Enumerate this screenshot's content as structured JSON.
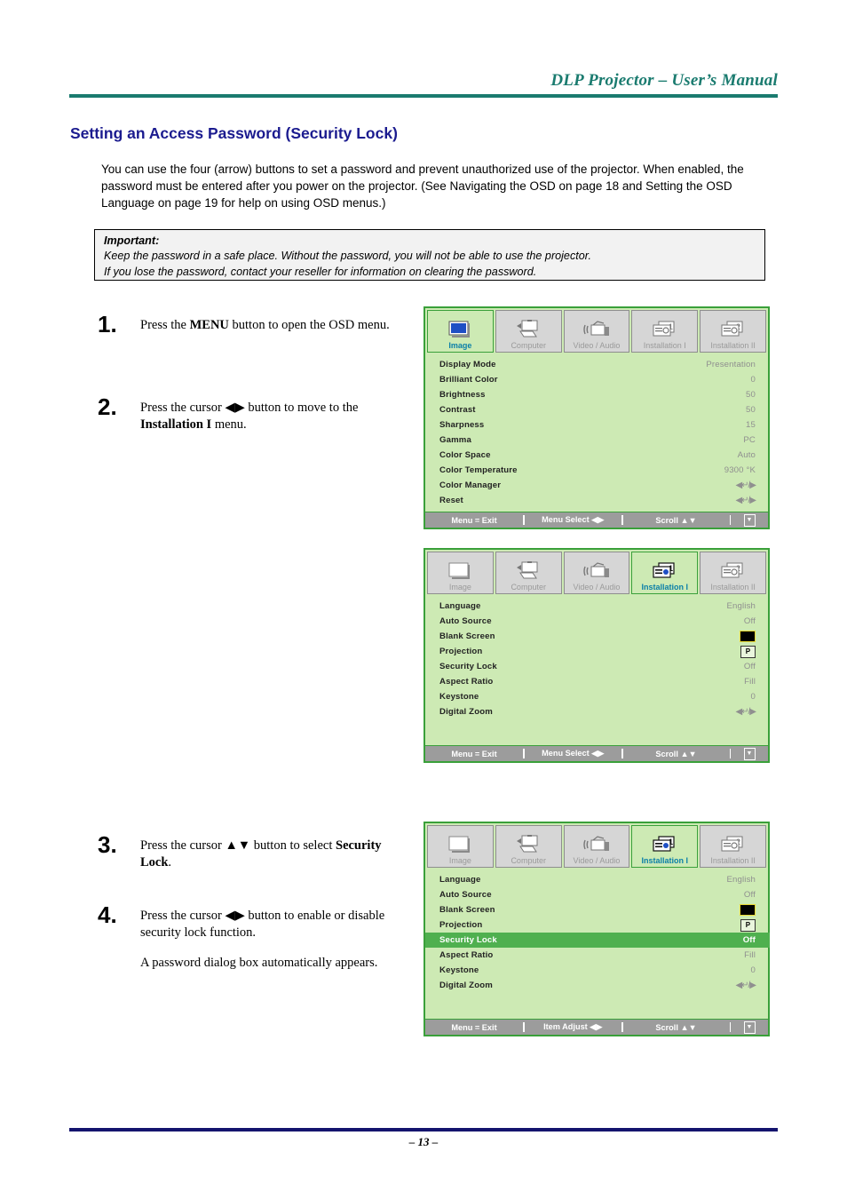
{
  "header": {
    "manual_title": "DLP Projector – User’s Manual",
    "accent_color": "#1a7b6f"
  },
  "section": {
    "heading": "Setting an Access Password (Security Lock)",
    "heading_color": "#1b1b8f",
    "intro": "You can use the four (arrow) buttons to set a password and prevent unauthorized use of the projector. When enabled, the password must be entered after you power on the projector. (See Navigating the OSD on page 18 and Setting the OSD Language on page 19 for help on using OSD menus.)"
  },
  "important": {
    "title": "Important:",
    "line1": "Keep the password in a safe place. Without the password, you will not be able to use the projector.",
    "line2": "If you lose the password, contact your reseller for information on clearing the password."
  },
  "steps": [
    {
      "number": "1.",
      "text_before": "Press the cursor ",
      "html_parts": [
        "Press the ",
        "MENU",
        " button to open the OSD menu."
      ],
      "lead": "Press the ",
      "bold": "MENU",
      "rest": " button to open the OSD menu."
    },
    {
      "number": "2.",
      "lead": "Press the cursor ◀▶ button to move to the ",
      "bold": "Installation I",
      "rest": " menu."
    },
    {
      "number": "3.",
      "lead": "Press the cursor ▲▼ button to select ",
      "bold": "Security Lock",
      "rest": "."
    },
    {
      "number": "4.",
      "lead": "Press the cursor ◀▶ button to enable or disable security lock function.",
      "bold": "",
      "rest": "",
      "note": "A password dialog box automatically appears."
    }
  ],
  "osd_common": {
    "tabs": [
      {
        "label": "Image",
        "icon": "screen-icon"
      },
      {
        "label": "Computer",
        "icon": "computer-icon"
      },
      {
        "label": "Video / Audio",
        "icon": "video-audio-icon"
      },
      {
        "label": "Installation I",
        "icon": "installation-1-icon"
      },
      {
        "label": "Installation II",
        "icon": "installation-2-icon"
      }
    ],
    "footer": {
      "exit": "Menu = Exit",
      "menu_select": "Menu Select ◀▶",
      "item_adjust": "Item Adjust ◀▶",
      "scroll": "Scroll ▲▼",
      "scroll_indicator": "▼"
    },
    "panel_bg": "#cdeab4",
    "border_color": "#3aa03a",
    "highlight_color": "#4fb04f",
    "footer_bar_color": "#9c9c9c"
  },
  "osd1": {
    "active_tab": "Image",
    "rows": [
      {
        "label": "Display Mode",
        "value": "Presentation"
      },
      {
        "label": "Brilliant Color",
        "value": "0"
      },
      {
        "label": "Brightness",
        "value": "50"
      },
      {
        "label": "Contrast",
        "value": "50"
      },
      {
        "label": "Sharpness",
        "value": "15"
      },
      {
        "label": "Gamma",
        "value": "PC"
      },
      {
        "label": "Color Space",
        "value": "Auto"
      },
      {
        "label": "Color Temperature",
        "value": "9300 °K"
      },
      {
        "label": "Color Manager",
        "value": "◀↵/▶",
        "type": "enter"
      },
      {
        "label": "Reset",
        "value": "◀↵/▶",
        "type": "enter"
      }
    ],
    "footer_mode": "Menu Select ◀▶"
  },
  "osd2": {
    "active_tab": "Installation I",
    "rows": [
      {
        "label": "Language",
        "value": "English"
      },
      {
        "label": "Auto Source",
        "value": "Off"
      },
      {
        "label": "Blank Screen",
        "value": "",
        "type": "swatch"
      },
      {
        "label": "Projection",
        "value": "P",
        "type": "projection"
      },
      {
        "label": "Security Lock",
        "value": "Off"
      },
      {
        "label": "Aspect Ratio",
        "value": "Fill"
      },
      {
        "label": "Keystone",
        "value": "0"
      },
      {
        "label": "Digital Zoom",
        "value": "◀↵/▶",
        "type": "enter"
      }
    ],
    "footer_mode": "Menu Select ◀▶"
  },
  "osd3": {
    "active_tab": "Installation I",
    "highlighted_row": "Security Lock",
    "rows": [
      {
        "label": "Language",
        "value": "English"
      },
      {
        "label": "Auto Source",
        "value": "Off"
      },
      {
        "label": "Blank Screen",
        "value": "",
        "type": "swatch"
      },
      {
        "label": "Projection",
        "value": "P",
        "type": "projection"
      },
      {
        "label": "Security Lock",
        "value": "Off",
        "highlight": true
      },
      {
        "label": "Aspect Ratio",
        "value": "Fill"
      },
      {
        "label": "Keystone",
        "value": "0"
      },
      {
        "label": "Digital Zoom",
        "value": "◀↵/▶",
        "type": "enter"
      }
    ],
    "footer_mode": "Item Adjust ◀▶"
  },
  "footer": {
    "page_number": "– 13 –"
  }
}
